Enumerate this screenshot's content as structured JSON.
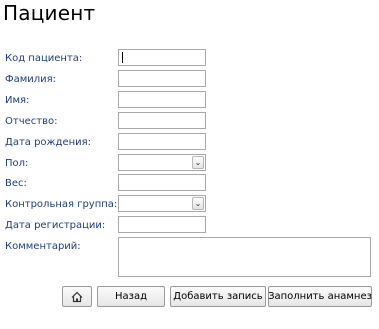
{
  "page": {
    "title": "Пациент"
  },
  "form": {
    "fields": [
      {
        "label": "Код пациента:",
        "value": ""
      },
      {
        "label": "Фамилия:",
        "value": ""
      },
      {
        "label": "Имя:",
        "value": ""
      },
      {
        "label": "Отчество:",
        "value": ""
      },
      {
        "label": "Дата рождения:",
        "value": ""
      },
      {
        "label": "Пол:",
        "value": ""
      },
      {
        "label": "Вес:",
        "value": ""
      },
      {
        "label": "Контрольная группа:",
        "value": ""
      },
      {
        "label": "Дата регистрации:",
        "value": ""
      },
      {
        "label": "Комментарий:",
        "value": ""
      }
    ]
  },
  "buttons": {
    "home_icon": "home-icon",
    "back": "Назад",
    "add": "Добавить запись",
    "anamnesis": "Заполнить анамнез"
  }
}
